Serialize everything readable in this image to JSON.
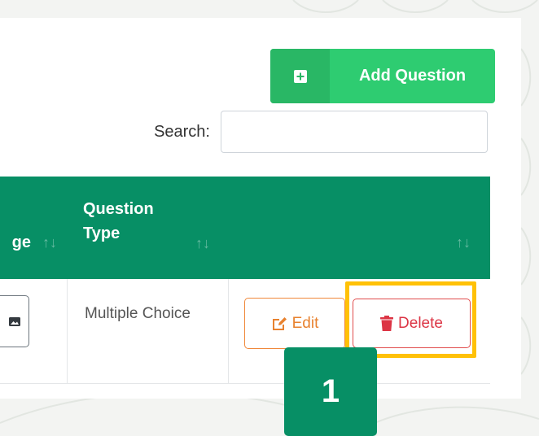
{
  "toolbar": {
    "add_question_label": "Add Question"
  },
  "search": {
    "label": "Search:",
    "value": "",
    "placeholder": ""
  },
  "table": {
    "columns": [
      {
        "label": "ge",
        "sort_icon": "sort-arrows-icon"
      },
      {
        "label": "Question Type",
        "sort_icon": "sort-arrows-icon"
      },
      {
        "label": "",
        "sort_icon": "sort-arrows-icon"
      }
    ],
    "sort_glyph": "↑↓",
    "rows": [
      {
        "image_icon": "image-icon",
        "question_type": "Multiple Choice",
        "edit_label": "Edit",
        "delete_label": "Delete"
      }
    ]
  },
  "annotation": {
    "step_number": "1"
  },
  "colors": {
    "primary": "#078f65",
    "add_button": "#2ecc71",
    "edit": "#e8822f",
    "delete": "#dc3545",
    "highlight": "#ffc107"
  }
}
